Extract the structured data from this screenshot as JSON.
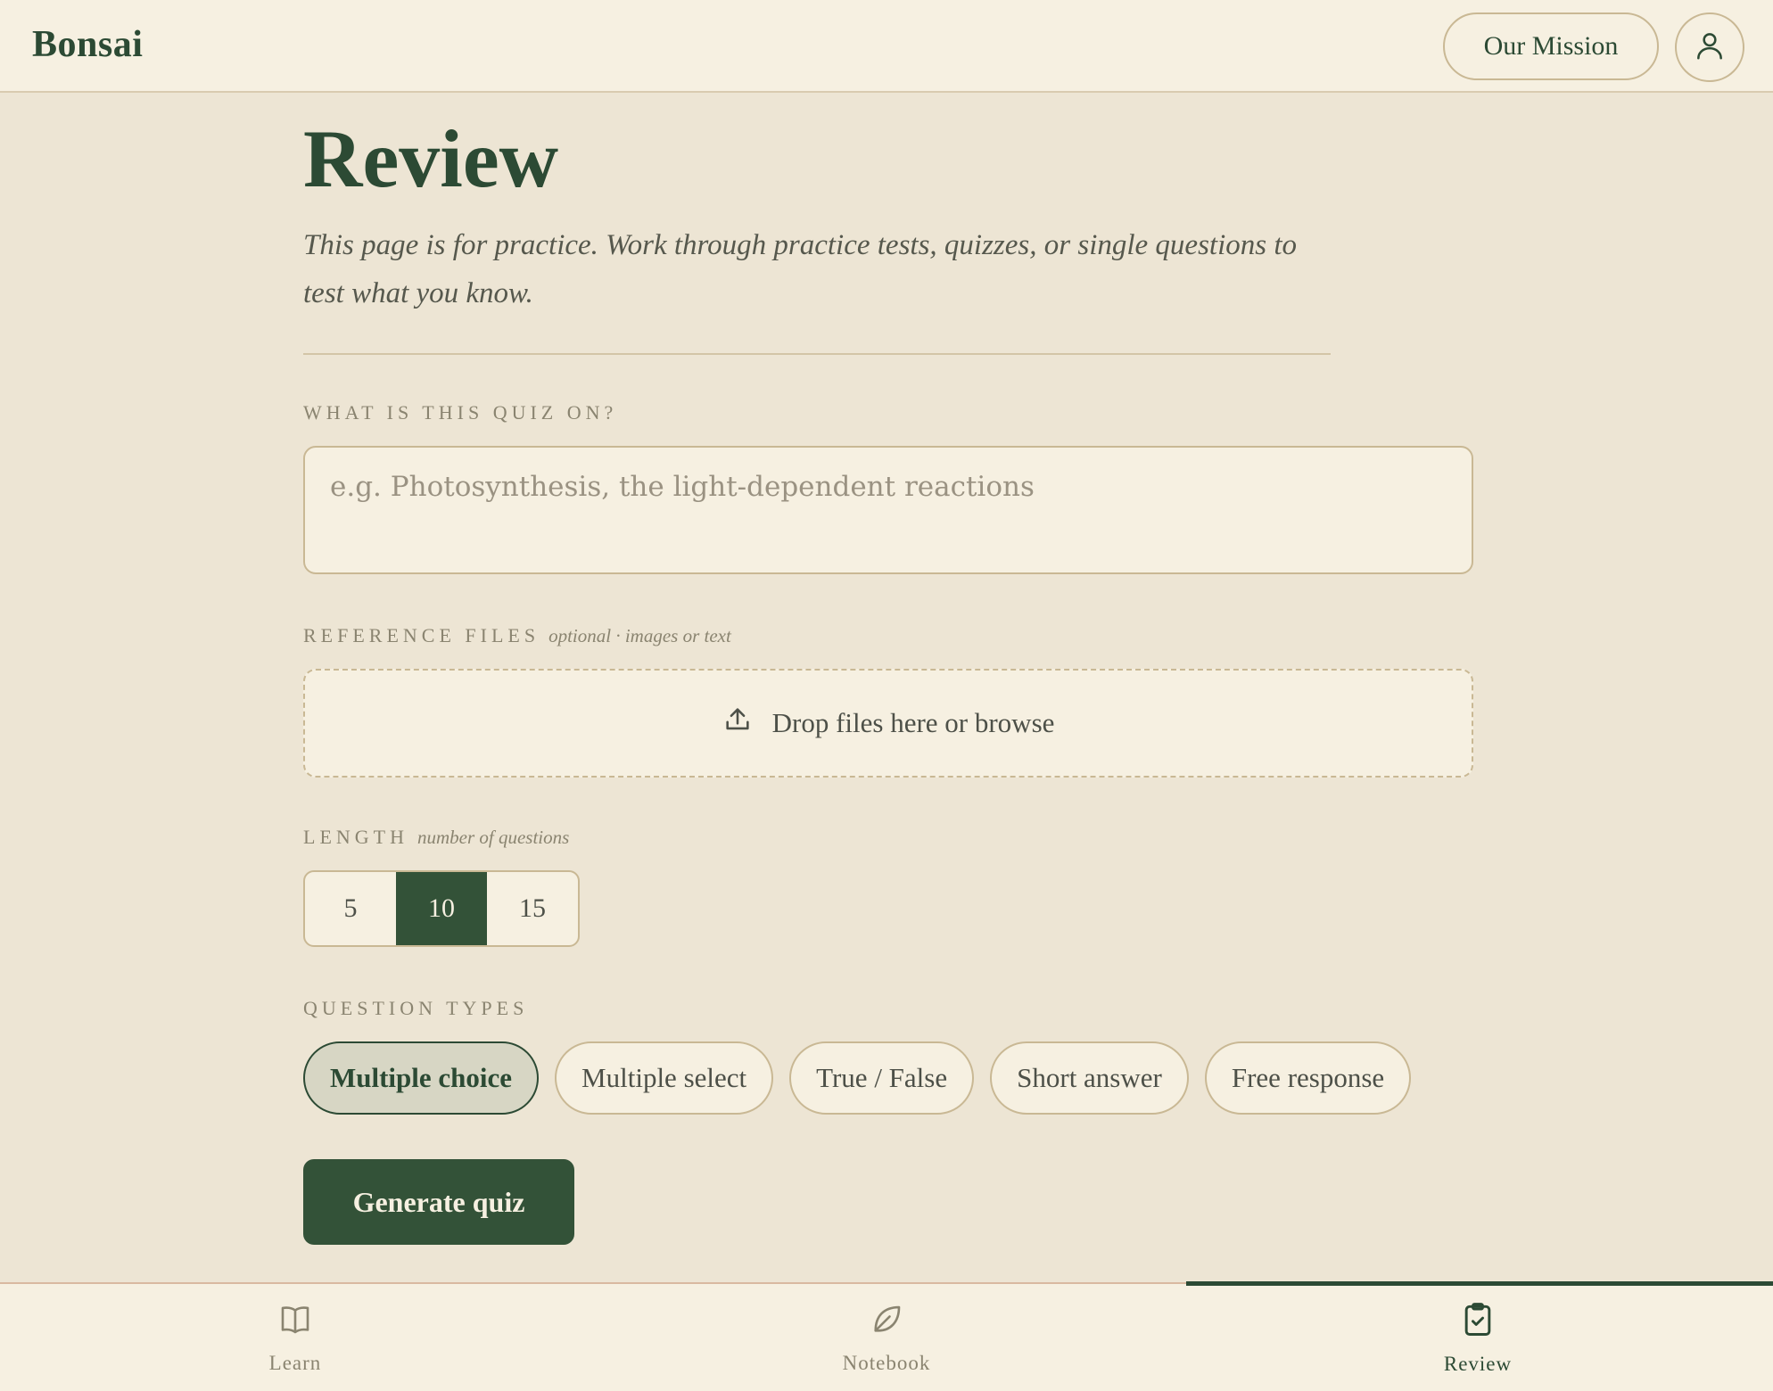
{
  "header": {
    "brand": "Bonsai",
    "mission_label": "Our Mission",
    "account_icon": "user-icon"
  },
  "page": {
    "title": "Review",
    "description": "This page is for practice. Work through practice tests, quizzes, or single questions to test what you know."
  },
  "topic": {
    "label": "WHAT IS THIS QUIZ ON?",
    "placeholder": "e.g. Photosynthesis, the light-dependent reactions",
    "value": ""
  },
  "files": {
    "label": "REFERENCE FILES",
    "hint": "optional · images or text",
    "dropzone_text": "Drop files here or browse",
    "icon": "upload-icon"
  },
  "length": {
    "label": "LENGTH",
    "hint": "number of questions",
    "options": [
      "5",
      "10",
      "15"
    ],
    "selected": "10"
  },
  "question_types": {
    "label": "QUESTION TYPES",
    "options": [
      "Multiple choice",
      "Multiple select",
      "True / False",
      "Short answer",
      "Free response"
    ],
    "selected": [
      "Multiple choice"
    ]
  },
  "generate_label": "Generate quiz",
  "bottom_nav": {
    "items": [
      {
        "label": "Learn",
        "icon": "book-icon"
      },
      {
        "label": "Notebook",
        "icon": "leaf-icon"
      },
      {
        "label": "Review",
        "icon": "clipboard-check-icon"
      }
    ],
    "active": "Review"
  },
  "colors": {
    "primary": "#335238",
    "background": "#ede5d4",
    "surface": "#f6f0e1",
    "border": "#c9b894"
  }
}
